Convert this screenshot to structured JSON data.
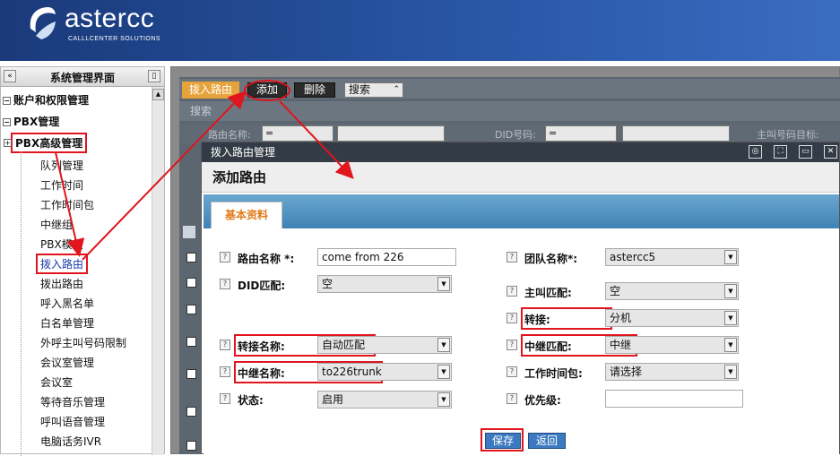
{
  "header": {
    "logo_text": "astercc",
    "logo_sub": "CALLLCENTER SOLUTIONS"
  },
  "sidebar": {
    "title": "系统管理界面",
    "groups": [
      "账户和权限管理",
      "PBX管理",
      "PBX高级管理"
    ],
    "items": [
      "队列管理",
      "工作时间",
      "工作时间包",
      "中继组",
      "PBX模板",
      "拨入路由",
      "拨出路由",
      "呼入黑名单",
      "白名单管理",
      "外呼主叫号码限制",
      "会议室管理",
      "会议室",
      "等待音乐管理",
      "呼叫语音管理",
      "电脑话务IVR"
    ]
  },
  "toolbar": {
    "tab_label": "拨入路由",
    "add_label": "添加",
    "delete_label": "删除",
    "search_label": "搜索"
  },
  "search": {
    "bar_label": "搜索",
    "f1_label": "路由名称:",
    "f1_op": "=",
    "f2_label": "DID号码:",
    "f2_op": "=",
    "f3_label": "主叫号码目标:"
  },
  "dialog": {
    "window_title": "拨入路由管理",
    "heading": "添加路由",
    "tab": "基本资料",
    "left_fields": [
      {
        "label": "路由名称 *:",
        "value": "come from 226"
      },
      {
        "label": "DID匹配:",
        "value": "空"
      },
      {
        "label": "转接名称:",
        "value": "自动匹配"
      },
      {
        "label": "中继名称:",
        "value": "to226trunk"
      },
      {
        "label": "状态:",
        "value": "启用"
      }
    ],
    "right_fields": [
      {
        "label": "团队名称*:",
        "value": "astercc5"
      },
      {
        "label": "主叫匹配:",
        "value": "空"
      },
      {
        "label": "转接:",
        "value": "分机"
      },
      {
        "label": "中继匹配:",
        "value": "中继"
      },
      {
        "label": "工作时间包:",
        "value": "请选择"
      },
      {
        "label": "优先级:",
        "value": ""
      }
    ],
    "save_label": "保存",
    "back_label": "返回"
  },
  "colors": {
    "highlight": "#e0151d",
    "header_blue": "#2a58a8",
    "tab_orange": "#e7a33b",
    "dialog_tab_blue": "#4a8cbf"
  }
}
